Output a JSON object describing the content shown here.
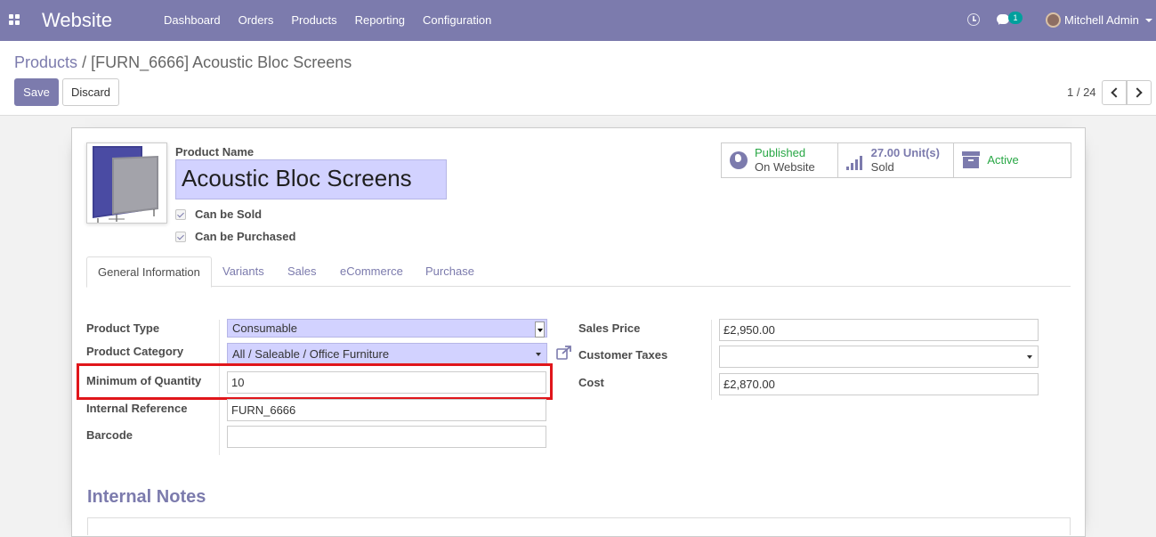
{
  "navbar": {
    "app_name": "Website",
    "menu": [
      "Dashboard",
      "Orders",
      "Products",
      "Reporting",
      "Configuration"
    ],
    "chat_badge": "1",
    "user": "Mitchell Admin",
    "icons": [
      "apps-icon",
      "clock-icon",
      "chat-icon",
      "avatar"
    ]
  },
  "breadcrumb": {
    "parent": "Products",
    "separator": "/",
    "current": "[FURN_6666] Acoustic Bloc Screens"
  },
  "buttons": {
    "save": "Save",
    "discard": "Discard"
  },
  "pager": {
    "value": "1 / 24"
  },
  "product": {
    "name_label": "Product Name",
    "name": "Acoustic Bloc Screens",
    "can_be_sold": "Can be Sold",
    "can_be_purchased": "Can be Purchased"
  },
  "smart_buttons": {
    "published_title": "Published",
    "published_sub": "On Website",
    "sold_value": "27.00 Unit(s)",
    "sold_sub": "Sold",
    "active": "Active"
  },
  "tabs": [
    "General Information",
    "Variants",
    "Sales",
    "eCommerce",
    "Purchase"
  ],
  "fields": {
    "product_type_label": "Product Type",
    "product_type": "Consumable",
    "product_category_label": "Product Category",
    "product_category": "All / Saleable / Office Furniture",
    "min_qty_label": "Minimum of Quantity",
    "min_qty": "10",
    "internal_ref_label": "Internal Reference",
    "internal_ref": "FURN_6666",
    "barcode_label": "Barcode",
    "barcode": "",
    "sales_price_label": "Sales Price",
    "sales_price": "£2,950.00",
    "customer_taxes_label": "Customer Taxes",
    "customer_taxes": "",
    "cost_label": "Cost",
    "cost": "£2,870.00"
  },
  "internal_notes_title": "Internal Notes",
  "colors": {
    "brand": "#7c7bad",
    "required_field": "#d2d2ff",
    "highlight": "#e0161b",
    "published": "#28a745"
  }
}
